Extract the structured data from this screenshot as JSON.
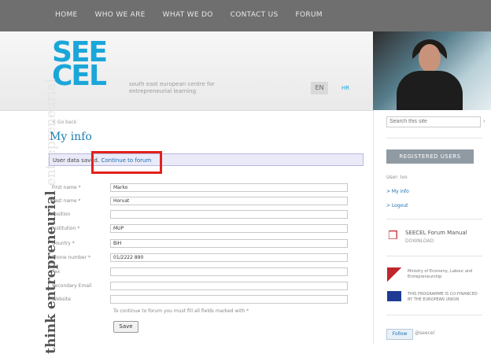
{
  "nav": {
    "items": [
      "HOME",
      "WHO WE ARE",
      "WHAT WE DO",
      "CONTACT US",
      "FORUM"
    ]
  },
  "header": {
    "logo_lines": [
      "SEE",
      "CEL"
    ],
    "tagline": "south east european centre for entrepreneurial learning",
    "lang_current": "EN",
    "lang_other": "HR"
  },
  "sidebar_vertical": {
    "text1": "think entrepreneurial",
    "text2": "entrepreneurial"
  },
  "main": {
    "breadcrumb": "< Go back",
    "title": "My info",
    "info_prefix": "User data saved.",
    "info_link": "Continue to forum",
    "fields": [
      {
        "label": "First name *",
        "value": "Marko"
      },
      {
        "label": "Last name *",
        "value": "Horvat"
      },
      {
        "label": "Position",
        "value": ""
      },
      {
        "label": "Institution *",
        "value": "MUP"
      },
      {
        "label": "Country *",
        "value": "BiH"
      },
      {
        "label": "Phone number *",
        "value": "01/2222 890"
      },
      {
        "label": "Fax",
        "value": ""
      },
      {
        "label": "Secondary Email",
        "value": ""
      },
      {
        "label": "Website",
        "value": ""
      }
    ],
    "note": "To continue to forum you must fill all fields marked with *",
    "save_label": "Save"
  },
  "right": {
    "search_placeholder": "Search this site",
    "search_go": "›",
    "registered_users": "REGISTERED USERS",
    "user_greeting": "User: Ivo",
    "link_my_info": "> My info",
    "link_logout": "> Logout",
    "manual_title": "SEECEL Forum Manual",
    "manual_sub": "DOWNLOAD",
    "ministry_text": "Ministry of Economy, Labour and Entrepreneurship",
    "eu_text": "THIS PROGRAMME IS CO-FINANCED BY THE EUROPEAN UNION",
    "twitter_follow": "Follow",
    "twitter_handle": "@seecel"
  },
  "colors": {
    "accent": "#1ba6d9",
    "highlight": "#e2201b",
    "nav_bg": "#6f6f6f"
  }
}
